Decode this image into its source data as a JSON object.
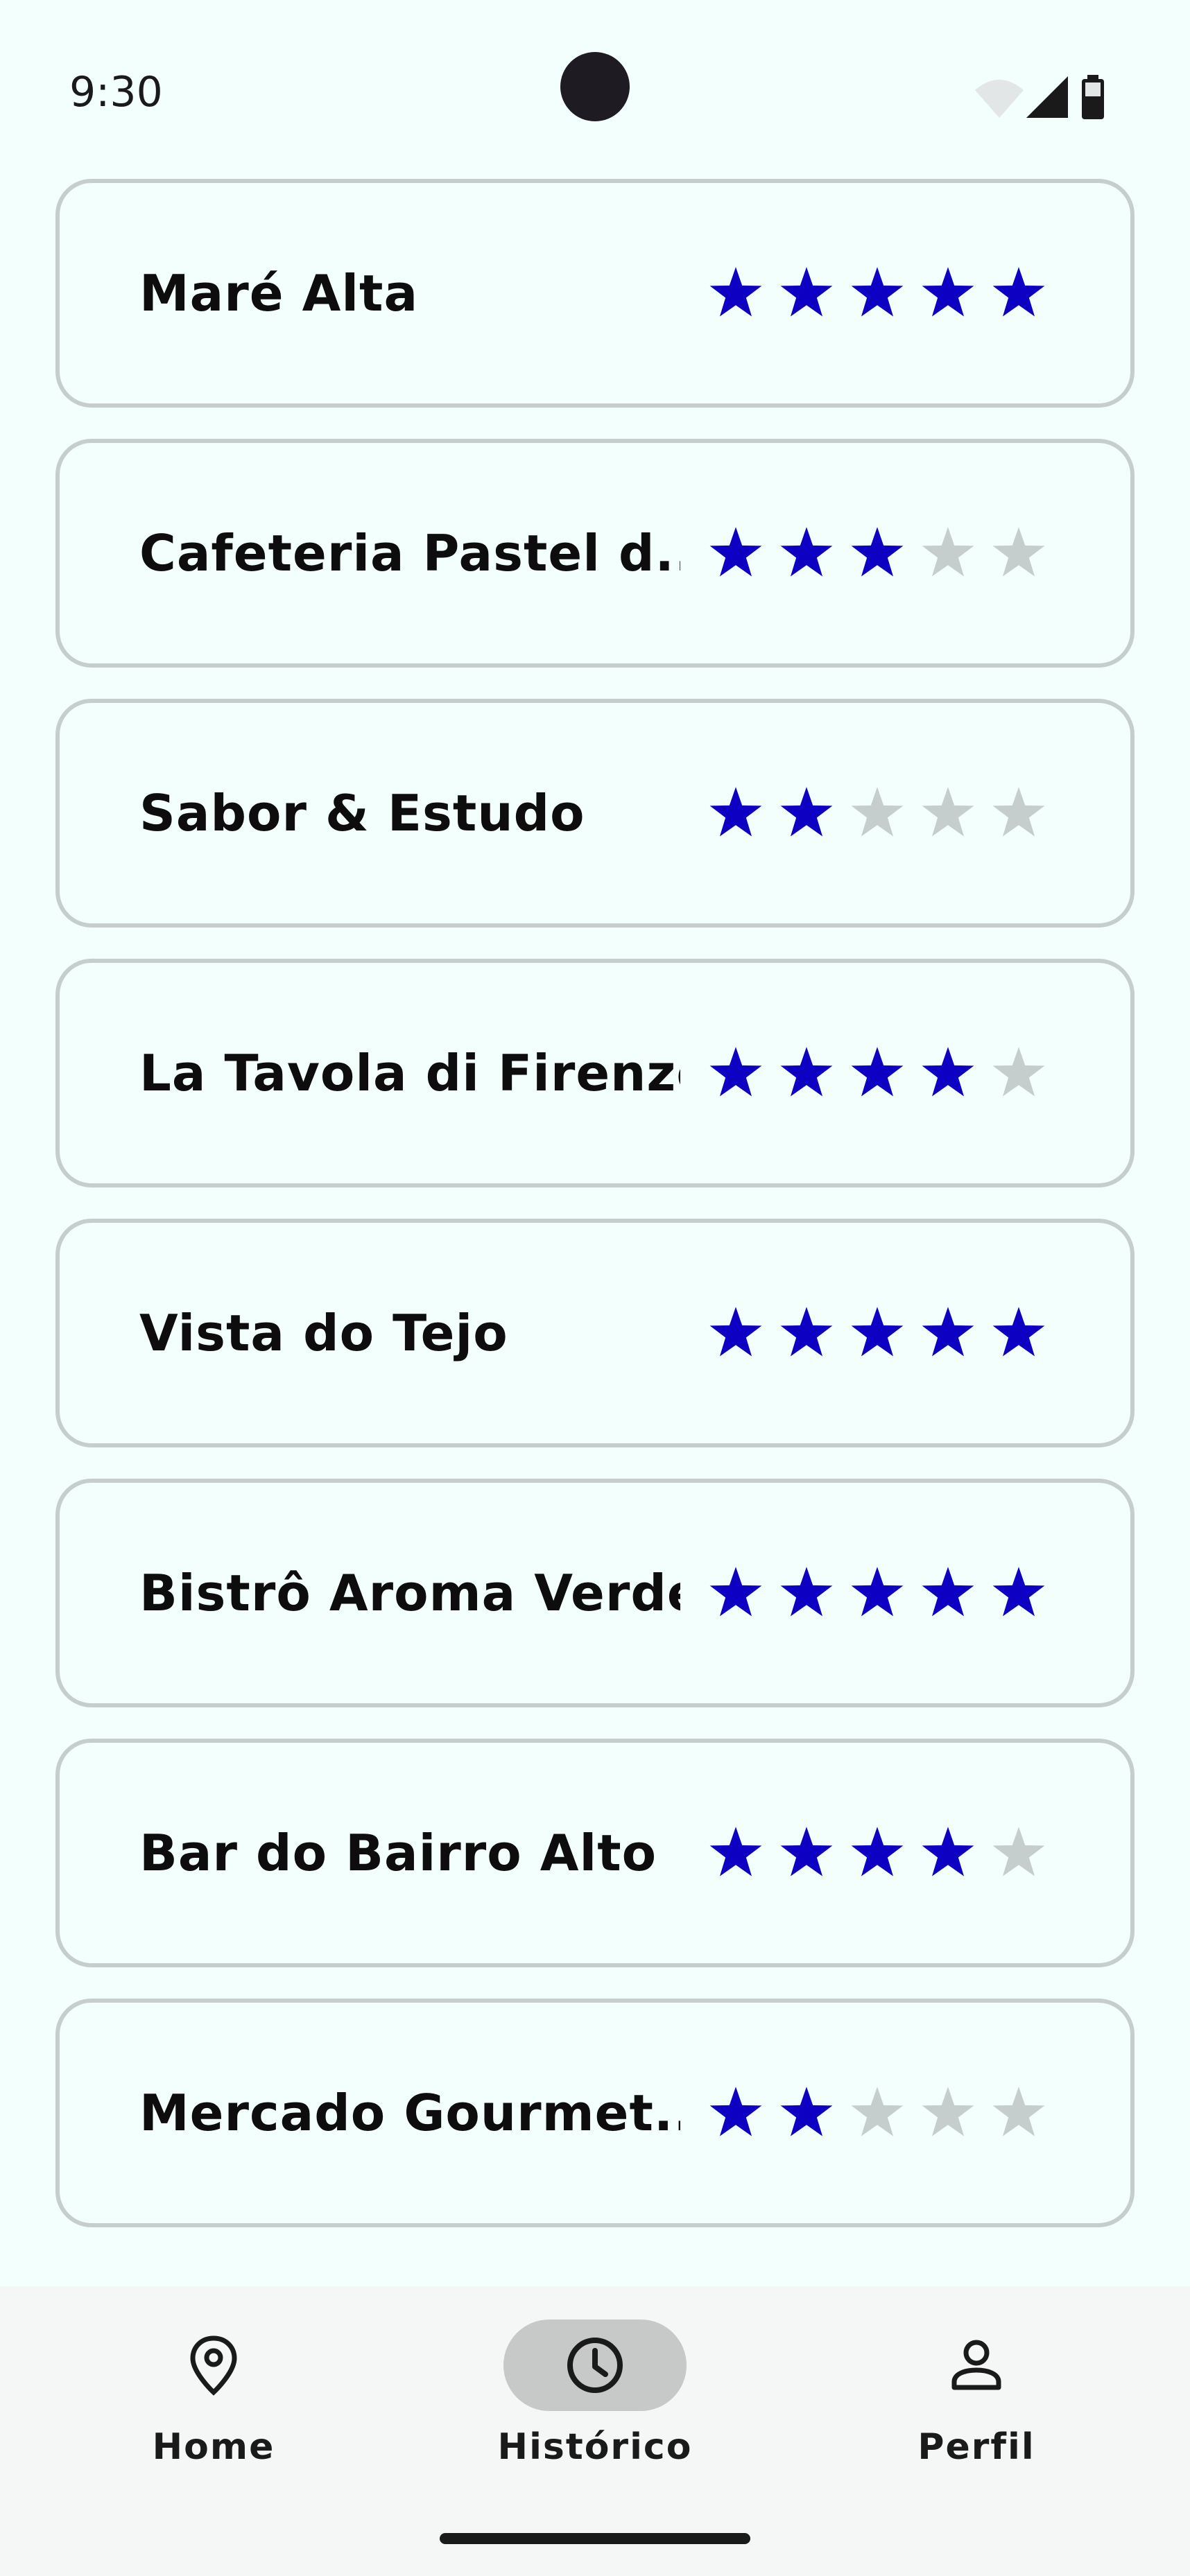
{
  "status_bar": {
    "time": "9:30",
    "icons": [
      "wifi-icon",
      "signal-icon",
      "battery-icon"
    ]
  },
  "colors": {
    "star_filled": "#0D00C2",
    "star_empty": "#C5CECD",
    "background": "#F2FFFD",
    "card_border": "#C5CECD",
    "nav_active": "#C7C8C8"
  },
  "restaurants": [
    {
      "name": "Maré Alta",
      "rating": 5
    },
    {
      "name": "Cafeteria Pastel d...",
      "rating": 3
    },
    {
      "name": "Sabor & Estudo",
      "rating": 2
    },
    {
      "name": "La Tavola di Firenze",
      "rating": 4
    },
    {
      "name": "Vista do Tejo",
      "rating": 5
    },
    {
      "name": "Bistrô Aroma Verde",
      "rating": 5
    },
    {
      "name": "Bar do Bairro Alto",
      "rating": 4
    },
    {
      "name": "Mercado Gourmet...",
      "rating": 2
    }
  ],
  "max_rating": 5,
  "nav": {
    "items": [
      {
        "label": "Home",
        "icon": "map-pin-icon",
        "active": false
      },
      {
        "label": "Histórico",
        "icon": "clock-icon",
        "active": true
      },
      {
        "label": "Perfil",
        "icon": "person-icon",
        "active": false
      }
    ]
  }
}
